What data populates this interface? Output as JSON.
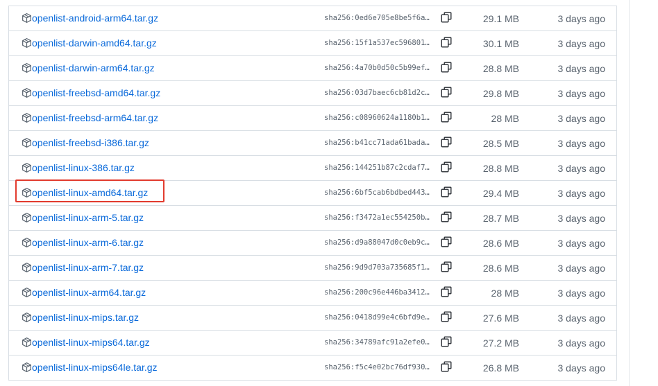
{
  "assets": [
    {
      "name": "openlist-android-arm64.tar.gz",
      "hash": "sha256:0ed6e705e8be5f6a…",
      "size": "29.1 MB",
      "date": "3 days ago"
    },
    {
      "name": "openlist-darwin-amd64.tar.gz",
      "hash": "sha256:15f1a537ec596801…",
      "size": "30.1 MB",
      "date": "3 days ago"
    },
    {
      "name": "openlist-darwin-arm64.tar.gz",
      "hash": "sha256:4a70b0d50c5b99ef…",
      "size": "28.8 MB",
      "date": "3 days ago"
    },
    {
      "name": "openlist-freebsd-amd64.tar.gz",
      "hash": "sha256:03d7baec6cb81d2c…",
      "size": "29.8 MB",
      "date": "3 days ago"
    },
    {
      "name": "openlist-freebsd-arm64.tar.gz",
      "hash": "sha256:c08960624a1180b1…",
      "size": "28 MB",
      "date": "3 days ago"
    },
    {
      "name": "openlist-freebsd-i386.tar.gz",
      "hash": "sha256:b41cc71ada61bada…",
      "size": "28.5 MB",
      "date": "3 days ago"
    },
    {
      "name": "openlist-linux-386.tar.gz",
      "hash": "sha256:144251b87c2cdaf7…",
      "size": "28.8 MB",
      "date": "3 days ago"
    },
    {
      "name": "openlist-linux-amd64.tar.gz",
      "hash": "sha256:6bf5cab6bdbed443…",
      "size": "29.4 MB",
      "date": "3 days ago"
    },
    {
      "name": "openlist-linux-arm-5.tar.gz",
      "hash": "sha256:f3472a1ec554250b…",
      "size": "28.7 MB",
      "date": "3 days ago"
    },
    {
      "name": "openlist-linux-arm-6.tar.gz",
      "hash": "sha256:d9a88047d0c0eb9c…",
      "size": "28.6 MB",
      "date": "3 days ago"
    },
    {
      "name": "openlist-linux-arm-7.tar.gz",
      "hash": "sha256:9d9d703a735685f1…",
      "size": "28.6 MB",
      "date": "3 days ago"
    },
    {
      "name": "openlist-linux-arm64.tar.gz",
      "hash": "sha256:200c96e446ba3412…",
      "size": "28 MB",
      "date": "3 days ago"
    },
    {
      "name": "openlist-linux-mips.tar.gz",
      "hash": "sha256:0418d99e4c6bfd9e…",
      "size": "27.6 MB",
      "date": "3 days ago"
    },
    {
      "name": "openlist-linux-mips64.tar.gz",
      "hash": "sha256:34789afc91a2efe0…",
      "size": "27.2 MB",
      "date": "3 days ago"
    },
    {
      "name": "openlist-linux-mips64le.tar.gz",
      "hash": "sha256:f5c4e02bc76df930…",
      "size": "26.8 MB",
      "date": "3 days ago"
    }
  ],
  "icons": {
    "asset": "package-icon",
    "copy": "copy-icon"
  },
  "colors": {
    "link": "#0969da",
    "muted": "#59636e",
    "border": "#d8dee4",
    "highlight": "#e23b2e"
  },
  "highlighted_asset": "openlist-linux-amd64.tar.gz"
}
